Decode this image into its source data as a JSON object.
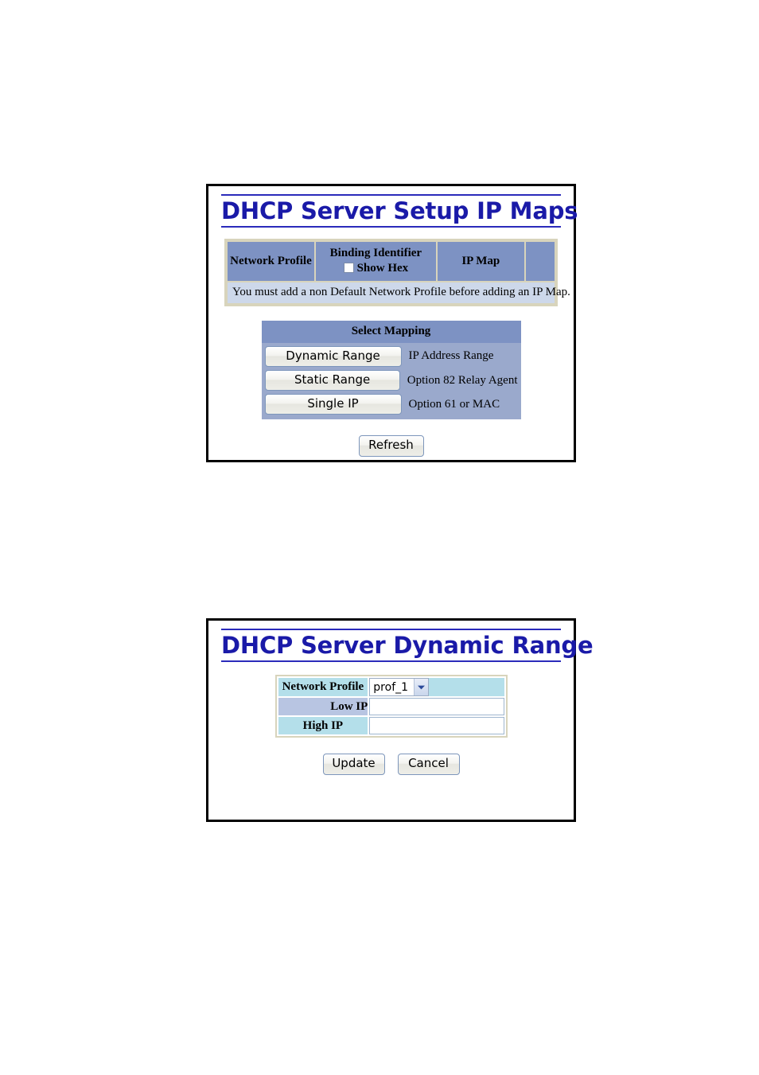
{
  "panel_one": {
    "title": "DHCP Server Setup IP Maps",
    "table": {
      "headers": {
        "network_profile": "Network Profile",
        "binding_identifier": "Binding Identifier",
        "show_hex": "Show Hex",
        "ip_map": "IP Map",
        "blank": ""
      },
      "notice": "You must add a non Default Network Profile before adding an IP Map."
    },
    "mapping": {
      "heading": "Select Mapping",
      "rows": [
        {
          "button": "Dynamic Range",
          "description": "IP Address Range"
        },
        {
          "button": "Static Range",
          "description": "Option 82 Relay Agent"
        },
        {
          "button": "Single IP",
          "description": "Option 61 or MAC"
        }
      ]
    },
    "refresh_label": "Refresh"
  },
  "panel_two": {
    "title": "DHCP Server Dynamic Range",
    "fields": [
      {
        "label": "Network Profile",
        "type": "select",
        "value": "prof_1",
        "tone": "a"
      },
      {
        "label": "Low IP",
        "type": "text",
        "value": "",
        "tone": "b"
      },
      {
        "label": "High IP",
        "type": "text",
        "value": "",
        "tone": "a"
      }
    ],
    "update_label": "Update",
    "cancel_label": "Cancel"
  },
  "colors": {
    "title_blue": "#1a1aa8",
    "header_blue": "#7d92c3",
    "notice_blue": "#cdd8ea",
    "tone_a": "#b4dfea",
    "tone_b": "#b8c5e2",
    "frame_tan": "#d8d4bc"
  }
}
